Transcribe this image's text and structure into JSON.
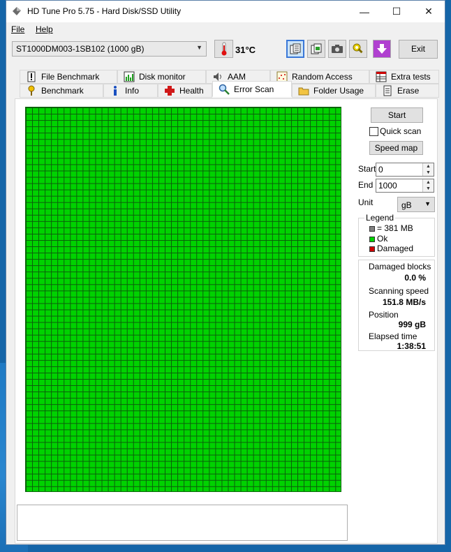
{
  "window": {
    "title": "HD Tune Pro 5.75 - Hard Disk/SSD Utility",
    "minimize": "—",
    "maximize": "☐",
    "close": "✕"
  },
  "menu": {
    "file_label": "File",
    "help_label": "Help"
  },
  "toolbar": {
    "drive": "ST1000DM003-1SB102 (1000 gB)",
    "temperature": "31°C",
    "exit_label": "Exit",
    "icons": [
      "copy-text-icon",
      "copy-screen-icon",
      "camera-icon",
      "options-icon",
      "download-icon"
    ]
  },
  "tabs": {
    "top": [
      "File Benchmark",
      "Disk monitor",
      "AAM",
      "Random Access",
      "Extra tests"
    ],
    "bottom": [
      "Benchmark",
      "Info",
      "Health",
      "Error Scan",
      "Folder Usage",
      "Erase"
    ],
    "active": "Error Scan"
  },
  "error_scan": {
    "start_label": "Start",
    "quick_scan_label": "Quick scan",
    "quick_scan_checked": false,
    "speed_map_label": "Speed map",
    "start_field_label": "Start",
    "start_value": "0",
    "end_field_label": "End",
    "end_value": "1000",
    "unit_label": "Unit",
    "unit_value": "gB",
    "legend_title": "Legend",
    "legend_block": "= 381 MB",
    "legend_ok": "Ok",
    "legend_damaged": "Damaged",
    "colors": {
      "ok": "#00d200",
      "damaged": "#d00000",
      "block": "#808080"
    },
    "damaged_blocks_label": "Damaged blocks",
    "damaged_blocks_value": "0.0 %",
    "scanning_speed_label": "Scanning speed",
    "scanning_speed_value": "151.8 MB/s",
    "position_label": "Position",
    "position_value": "999 gB",
    "elapsed_label": "Elapsed time",
    "elapsed_value": "1:38:51"
  }
}
